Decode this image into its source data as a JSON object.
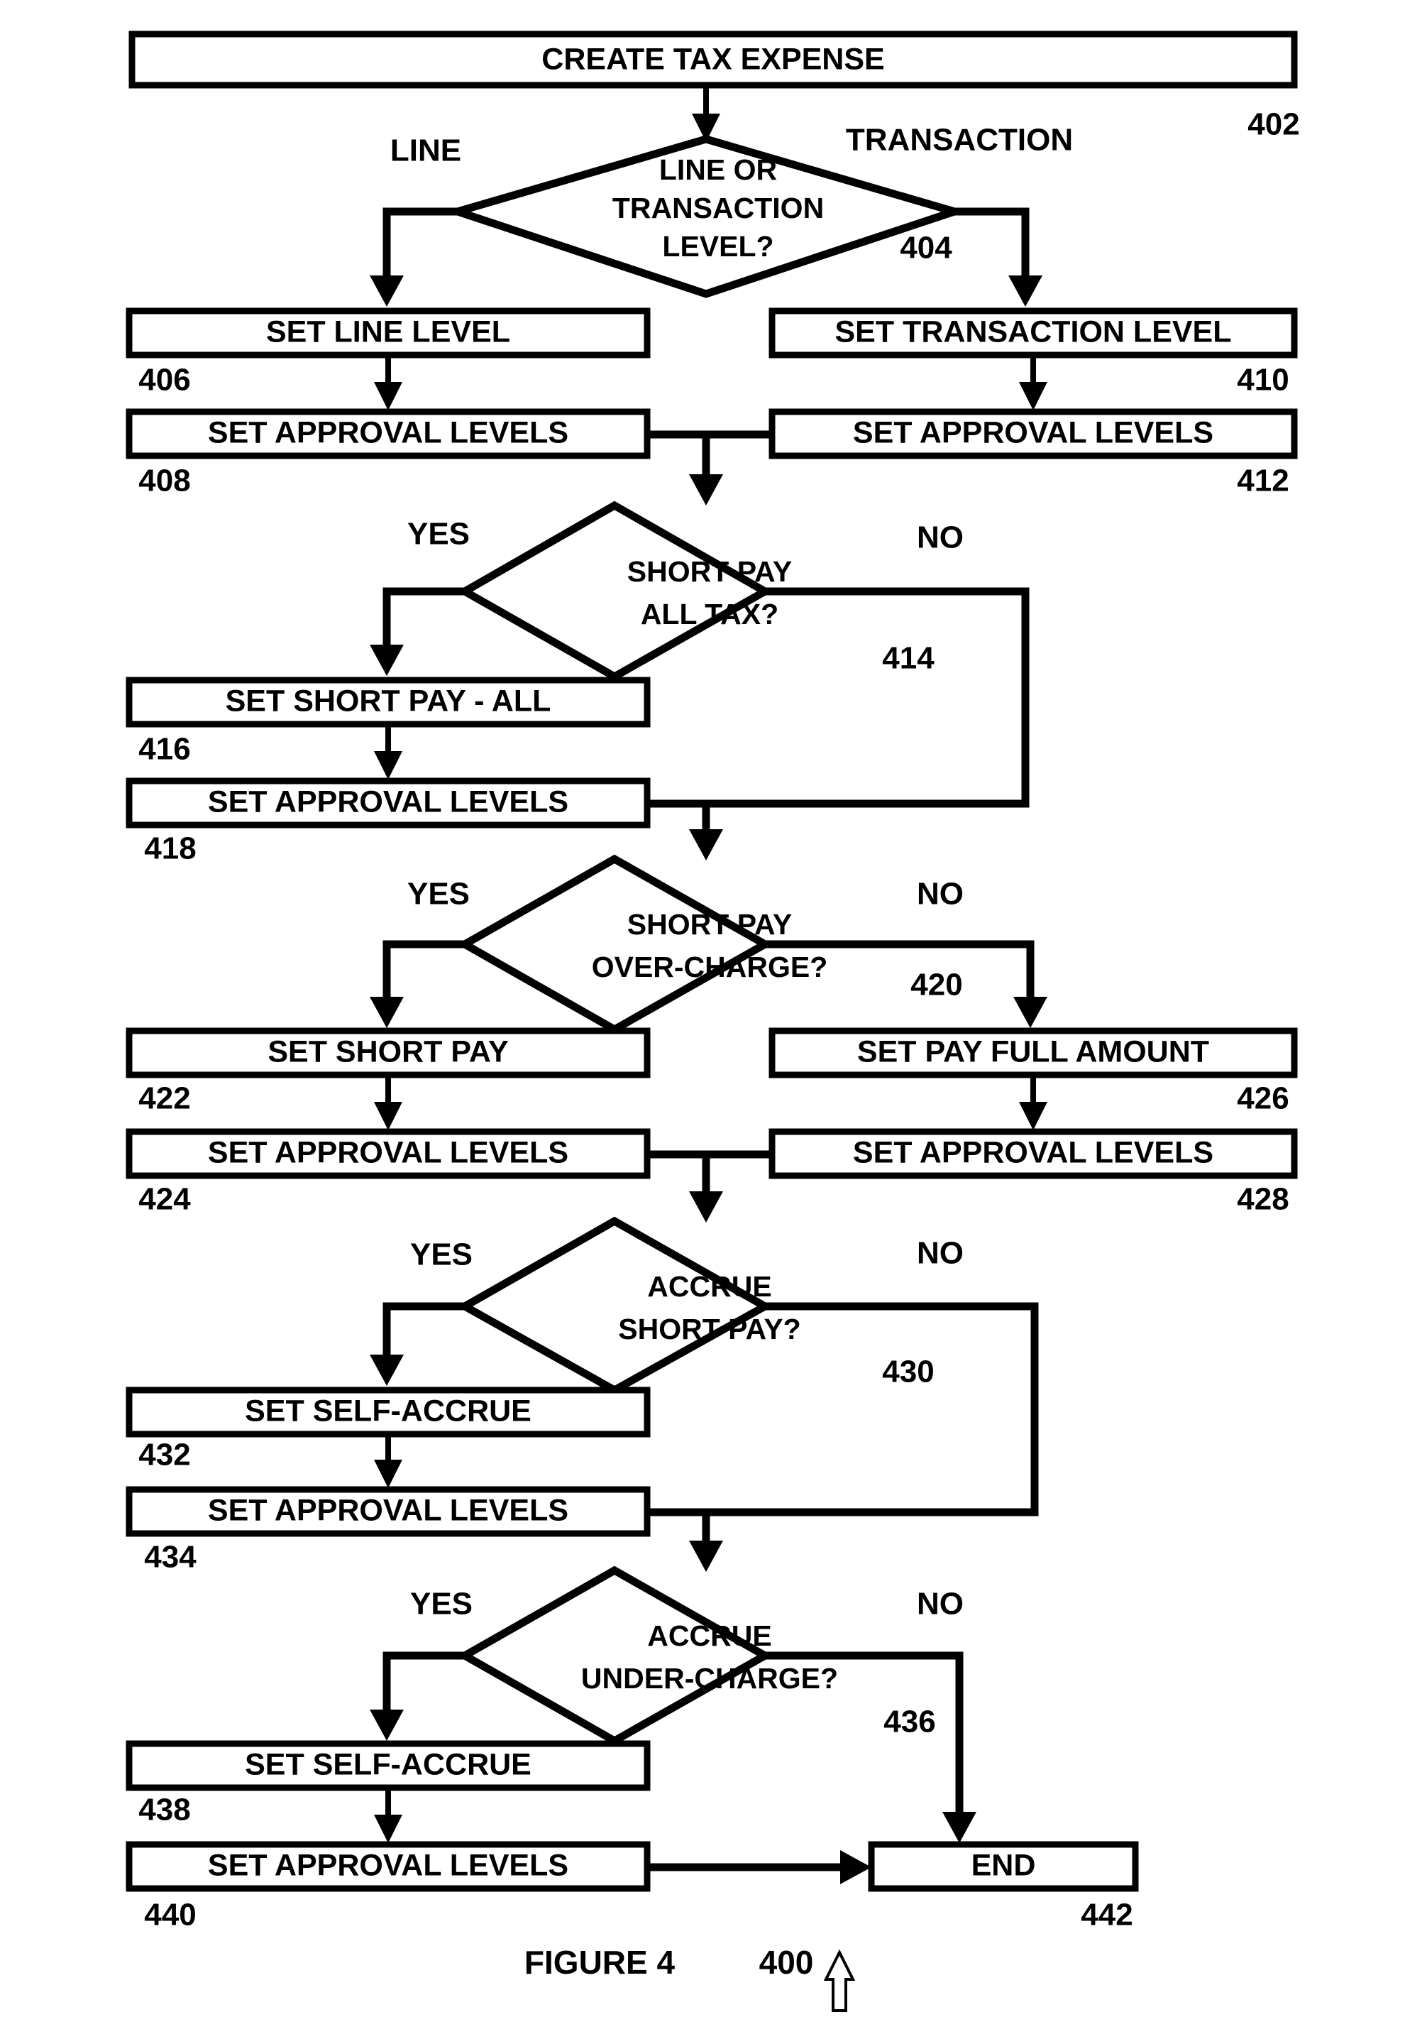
{
  "figure": {
    "caption": "FIGURE 4",
    "figure_ref": "400",
    "pointer_icon": "up-arrow-outline-icon"
  },
  "nodes": {
    "n402": {
      "label": "CREATE TAX EXPENSE",
      "ref": "402",
      "type": "process"
    },
    "n404": {
      "label_line1": "LINE OR",
      "label_line2": "TRANSACTION",
      "label_line3": "LEVEL?",
      "ref": "404",
      "type": "decision"
    },
    "n406": {
      "label": "SET LINE LEVEL",
      "ref": "406",
      "type": "process"
    },
    "n408": {
      "label": "SET APPROVAL LEVELS",
      "ref": "408",
      "type": "process"
    },
    "n410": {
      "label": "SET TRANSACTION LEVEL",
      "ref": "410",
      "type": "process"
    },
    "n412": {
      "label": "SET APPROVAL LEVELS",
      "ref": "412",
      "type": "process"
    },
    "n414": {
      "label_line1": "SHORT PAY",
      "label_line2": "ALL TAX?",
      "ref": "414",
      "type": "decision"
    },
    "n416": {
      "label": "SET SHORT PAY - ALL",
      "ref": "416",
      "type": "process"
    },
    "n418": {
      "label": "SET APPROVAL LEVELS",
      "ref": "418",
      "type": "process"
    },
    "n420": {
      "label_line1": "SHORT PAY",
      "label_line2": "OVER-CHARGE?",
      "ref": "420",
      "type": "decision"
    },
    "n422": {
      "label": "SET SHORT PAY",
      "ref": "422",
      "type": "process"
    },
    "n424": {
      "label": "SET APPROVAL LEVELS",
      "ref": "424",
      "type": "process"
    },
    "n426": {
      "label": "SET PAY FULL AMOUNT",
      "ref": "426",
      "type": "process"
    },
    "n428": {
      "label": "SET APPROVAL LEVELS",
      "ref": "428",
      "type": "process"
    },
    "n430": {
      "label_line1": "ACCRUE",
      "label_line2": "SHORT PAY?",
      "ref": "430",
      "type": "decision"
    },
    "n432": {
      "label": "SET SELF-ACCRUE",
      "ref": "432",
      "type": "process"
    },
    "n434": {
      "label": "SET APPROVAL LEVELS",
      "ref": "434",
      "type": "process"
    },
    "n436": {
      "label_line1": "ACCRUE",
      "label_line2": "UNDER-CHARGE?",
      "ref": "436",
      "type": "decision"
    },
    "n438": {
      "label": "SET SELF-ACCRUE",
      "ref": "438",
      "type": "process"
    },
    "n440": {
      "label": "SET APPROVAL LEVELS",
      "ref": "440",
      "type": "process"
    },
    "n442": {
      "label": "END",
      "ref": "442",
      "type": "terminator"
    }
  },
  "edge_labels": {
    "d404_left": "LINE",
    "d404_right": "TRANSACTION",
    "d414_yes": "YES",
    "d414_no": "NO",
    "d420_yes": "YES",
    "d420_no": "NO",
    "d430_yes": "YES",
    "d430_no": "NO",
    "d436_yes": "YES",
    "d436_no": "NO"
  },
  "colors": {
    "stroke": "#000000",
    "fill": "#ffffff"
  }
}
